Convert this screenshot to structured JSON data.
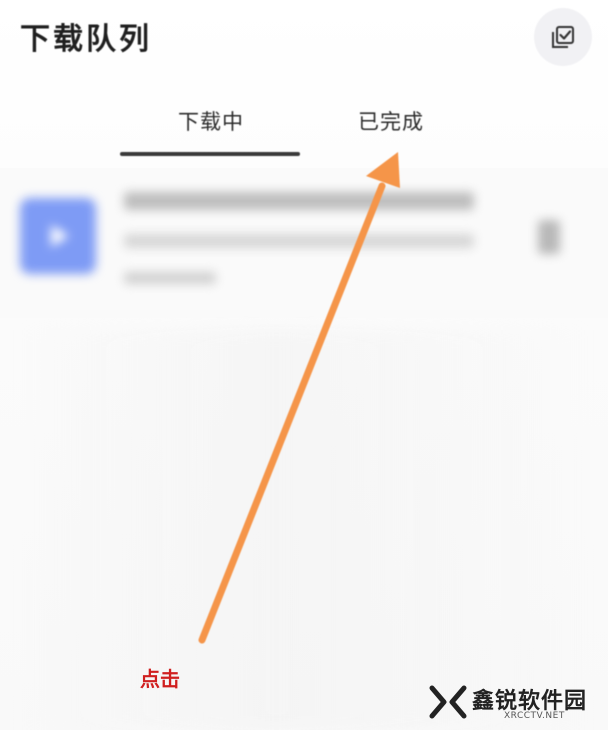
{
  "header": {
    "title": "下载队列",
    "action_icon": "checklist-icon"
  },
  "tabs": [
    {
      "label": "下载中",
      "active": true
    },
    {
      "label": "已完成",
      "active": false
    }
  ],
  "download_item": {
    "thumbnail_icon": "play-icon",
    "thumbnail_color": "#7e9bf5",
    "more_icon": "more-icon"
  },
  "annotation": {
    "label": "点击",
    "label_color": "#d01f1f",
    "arrow_color": "#f5954a"
  },
  "watermark": {
    "name": "鑫锐软件园",
    "domain": "XRCCTV.NET"
  }
}
